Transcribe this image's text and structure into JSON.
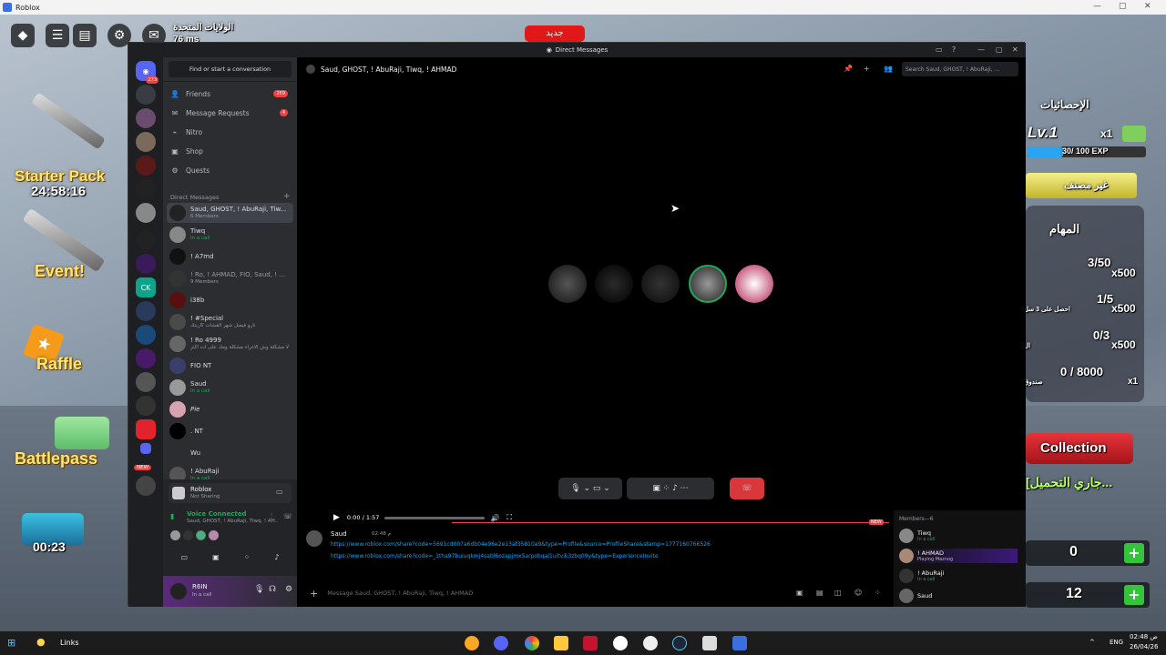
{
  "roblox": {
    "window_title": "Roblox",
    "region_label": "الولايات المتحدة",
    "ping": "76 ms",
    "new_badge": "جديد",
    "starter_pack": "Starter Pack",
    "starter_timer": "24:58:16",
    "event_label": "Event!",
    "raffle_label": "Raffle",
    "battlepass_label": "Battlepass",
    "crate_timer": "00:23",
    "stats_title": "الإحصائيات",
    "level": "Lv.1",
    "level_mult": "x1",
    "exp": "30/ 100 EXP",
    "unclassified": "غير مصنف",
    "missions_title": "المهام",
    "missions": [
      {
        "progress": "3/50",
        "reward": "x500",
        "desc": ""
      },
      {
        "progress": "1/5",
        "reward": "x500",
        "desc": "احصل على 3 سل"
      },
      {
        "progress": "0/3",
        "reward": "x500",
        "desc": "ال"
      },
      {
        "progress": "0 / 8000",
        "reward": "x1",
        "desc": "صندوق"
      }
    ],
    "collection": "Collection",
    "loading": "[جاري التحميل...",
    "gems": "0",
    "coins": "12",
    "plus": "+"
  },
  "discord": {
    "window_title": "Direct Messages",
    "find_conversation": "Find or start a conversation",
    "guild_badge_top": "273",
    "new_label": "NEW",
    "nav": [
      {
        "label": "Friends",
        "badge": "269",
        "icon": "friends-icon"
      },
      {
        "label": "Message Requests",
        "badge": "4",
        "icon": "inbox-icon"
      },
      {
        "label": "Nitro",
        "badge": "",
        "icon": "nitro-icon"
      },
      {
        "label": "Shop",
        "badge": "",
        "icon": "shop-icon"
      },
      {
        "label": "Quests",
        "badge": "",
        "icon": "quests-icon"
      }
    ],
    "dm_header": "Direct Messages",
    "dms": [
      {
        "name": "Saud, GHOST, ! AbuRaji, Tiw...",
        "sub": "6 Members"
      },
      {
        "name": "Tiwq",
        "sub": "In a call"
      },
      {
        "name": "! A7md",
        "sub": ""
      },
      {
        "name": "! Ro, ! AHMAD, FIO, Saud, ! ...",
        "sub": "9 Members"
      },
      {
        "name": "i38b",
        "sub": ""
      },
      {
        "name": "! #Special",
        "sub": "تارو فيصل شهر القشات كاربتك"
      },
      {
        "name": "! Ro 4999",
        "sub": "لا مشكلة وش الاغراء مشكلة ومك على ات اكثر"
      },
      {
        "name": "FIO NT",
        "sub": ""
      },
      {
        "name": "Saud",
        "sub": "In a call"
      },
      {
        "name": "Pie",
        "sub": ""
      },
      {
        "name": ". NT",
        "sub": ""
      },
      {
        "name": "Wu",
        "sub": ""
      },
      {
        "name": "! AbuRaji",
        "sub": "In a call"
      }
    ],
    "activity": {
      "name": "Roblox",
      "sub": "Not Sharing"
    },
    "voice": {
      "status": "Voice Connected",
      "channel": "Saud, GHOST, ! AbuRaji, Tiwq, ! AH..."
    },
    "user": {
      "name": "R6IN",
      "status": "In a call"
    },
    "chat_title": "Saud, GHOST, ! AbuRaji, Tiwq, ! AHMAD",
    "search_placeholder": "Search Saud, GHOST, ! AbuRaji, ...",
    "player_time": "0:00 / 1:57",
    "message": {
      "author": "Saud",
      "time": "02:48 م",
      "new_tag": "NEW",
      "link1": "https://www.roblox.com/share?code=5691cd007a6db04e96e2e13af35810a9&type=Profile&source=ProfileShare&stamp=1777160766526",
      "link2": "https://www.roblox.com/share?code=_1tha97buiuqkmj4sabl6ozapjmx5arpobqal1uitvik3zbq09y&type=ExperienceInvite"
    },
    "msg_placeholder": "Message Saud, GHOST, ! AbuRaji, Tiwq, ! AHMAD",
    "members_header": "Members—6",
    "members": [
      {
        "name": "Tiwq",
        "sub": "In a call"
      },
      {
        "name": "! AHMAD",
        "sub": "Playing Maznog"
      },
      {
        "name": "! AbuRaji",
        "sub": "In a call"
      },
      {
        "name": "Saud",
        "sub": ""
      }
    ]
  },
  "taskbar": {
    "search": "Links",
    "lang": "ENG",
    "time": "02:48 ص",
    "date": "26/04/26"
  }
}
